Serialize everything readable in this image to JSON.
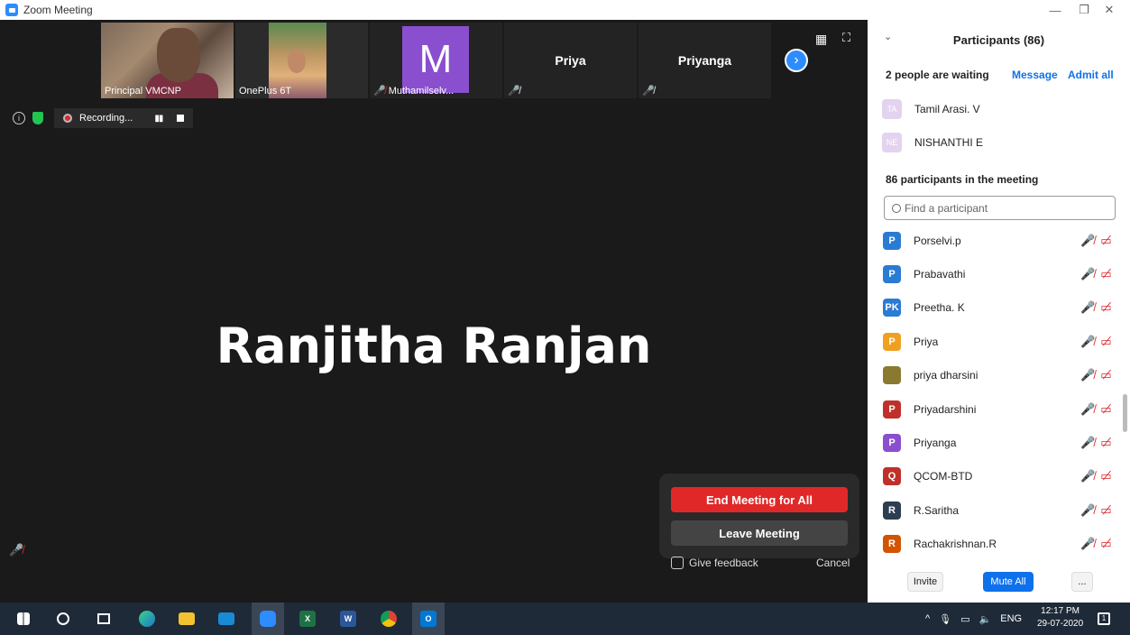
{
  "window": {
    "title": "Zoom Meeting",
    "minimize": "—",
    "restore": "❐",
    "close": "✕"
  },
  "thumbnails": [
    {
      "name": "Principal VMCNP",
      "type": "video"
    },
    {
      "name": "OnePlus 6T",
      "type": "video"
    },
    {
      "name": "Muthamilselv...",
      "type": "avatar",
      "avatar_letter": "M",
      "muted": true
    },
    {
      "big_name": "Priya",
      "muted": true
    },
    {
      "big_name": "Priyanga",
      "muted": true
    }
  ],
  "top_right_icons": {
    "next": "›",
    "grid": "▦",
    "fullscreen": "⛶"
  },
  "recording": {
    "label": "Recording...",
    "pause": "▮▮"
  },
  "active_speaker": "Ranjitha Ranjan",
  "end_panel": {
    "end_all": "End Meeting for All",
    "leave": "Leave Meeting",
    "feedback": "Give feedback",
    "cancel": "Cancel"
  },
  "participants": {
    "title": "Participants (86)",
    "waiting_label": "2 people are waiting",
    "message": "Message",
    "admit_all": "Admit all",
    "waiting": [
      {
        "initials": "TA",
        "name": "Tamil Arasi. V"
      },
      {
        "initials": "NE",
        "name": "NISHANTHI E"
      }
    ],
    "in_meeting_label": "86 participants in the meeting",
    "search_placeholder": "Find a participant",
    "list": [
      {
        "initial": "P",
        "name": "Porselvi.p",
        "color": "#2a7bd4"
      },
      {
        "initial": "P",
        "name": "Prabavathi",
        "color": "#2a7bd4"
      },
      {
        "initial": "PK",
        "name": "Preetha. K",
        "color": "#2a7bd4"
      },
      {
        "initial": "P",
        "name": "Priya",
        "color": "#f0a020"
      },
      {
        "initial": "",
        "name": "priya dharsini",
        "color": "#8a7a30"
      },
      {
        "initial": "P",
        "name": "Priyadarshini",
        "color": "#c0302a"
      },
      {
        "initial": "P",
        "name": "Priyanga",
        "color": "#8a4fcf"
      },
      {
        "initial": "Q",
        "name": "QCOM-BTD",
        "color": "#c0302a"
      },
      {
        "initial": "R",
        "name": "R.Saritha",
        "color": "#2c3e50"
      },
      {
        "initial": "R",
        "name": "Rachakrishnan.R",
        "color": "#d35400"
      }
    ],
    "footer": {
      "invite": "Invite",
      "mute_all": "Mute All",
      "more": "..."
    }
  },
  "taskbar": {
    "apps": [
      "start",
      "search",
      "task-view",
      "edge",
      "file-explorer",
      "mail",
      "zoom",
      "excel",
      "word",
      "chrome",
      "outlook"
    ],
    "tray_lang": "ENG",
    "time": "12:17 PM",
    "date": "29-07-2020",
    "notification_count": "1"
  }
}
